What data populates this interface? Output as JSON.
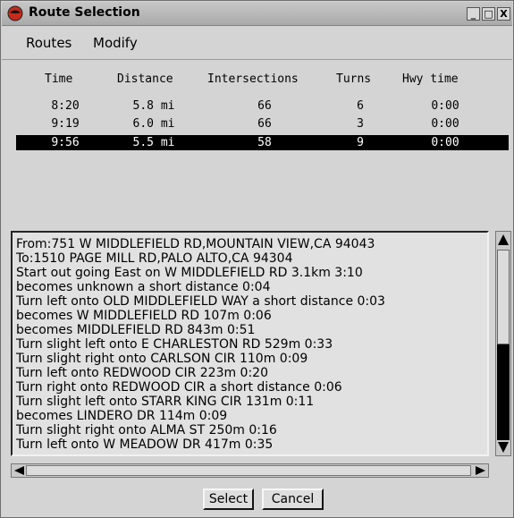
{
  "window": {
    "title": "Route Selection",
    "min_label": "_",
    "max_label": "□",
    "close_label": "X"
  },
  "menu": {
    "items": [
      "Routes",
      "Modify"
    ]
  },
  "table": {
    "columns": [
      "Time",
      "Distance",
      "Intersections",
      "Turns",
      "Hwy time"
    ],
    "rows": [
      [
        "8:20",
        "5.8 mi",
        "66",
        "6",
        "0:00"
      ],
      [
        "9:19",
        "6.0 mi",
        "66",
        "3",
        "0:00"
      ],
      [
        "9:56",
        "5.5 mi",
        "58",
        "9",
        "0:00"
      ]
    ],
    "selected_row": 2
  },
  "directions": [
    "From:751 W MIDDLEFIELD RD,MOUNTAIN VIEW,CA 94043",
    "To:1510 PAGE MILL RD,PALO ALTO,CA 94304",
    "Start out going East on W MIDDLEFIELD RD 3.1km 3:10",
    "becomes unknown a short distance 0:04",
    "Turn left onto OLD MIDDLEFIELD WAY a short distance 0:03",
    "becomes W MIDDLEFIELD RD 107m 0:06",
    "becomes MIDDLEFIELD RD 843m 0:51",
    "Turn slight left onto E CHARLESTON RD 529m 0:33",
    "Turn slight right onto CARLSON CIR 110m 0:09",
    "Turn left onto REDWOOD CIR 223m 0:20",
    "Turn right onto REDWOOD CIR a short distance 0:06",
    "Turn slight left onto STARR KING CIR 131m 0:11",
    "becomes LINDERO DR 114m 0:09",
    "Turn slight right onto ALMA ST 250m 0:16",
    "Turn left onto W MEADOW DR 417m 0:35"
  ],
  "buttons": {
    "select": "Select",
    "cancel": "Cancel"
  },
  "colors": {
    "selected_row_bg": "#000000",
    "selected_row_fg": "#ffffff",
    "icon_red": "#c62a1e"
  }
}
